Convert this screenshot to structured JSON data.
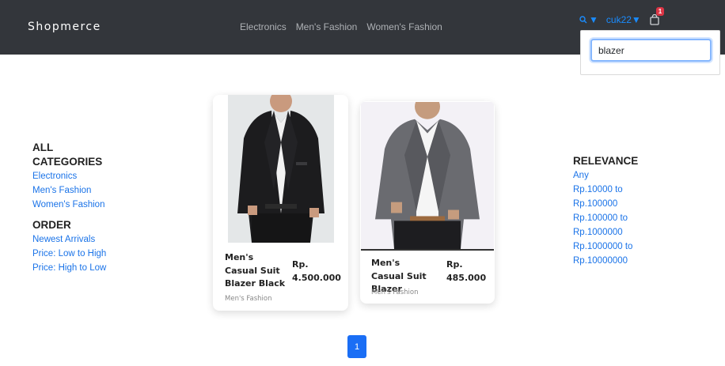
{
  "header": {
    "brand": "Shopmerce",
    "nav": [
      "Electronics",
      "Men's Fashion",
      "Women's Fashion"
    ],
    "search_toggle_icon": "search-icon",
    "search_caret": "▼",
    "user": "cuk22▼",
    "cart_count": "1"
  },
  "search": {
    "value": "blazer"
  },
  "filters": {
    "categories_title": "ALL CATEGORIES",
    "categories": [
      "Electronics",
      "Men's Fashion",
      "Women's Fashion"
    ],
    "order_title": "ORDER",
    "order": [
      "Newest Arrivals",
      "Price: Low to High",
      "Price: High to Low"
    ],
    "price_title": "RELEVANCE",
    "price": [
      "Any",
      "Rp.10000 to Rp.100000",
      "Rp.100000 to Rp.1000000",
      "Rp.1000000 to Rp.10000000"
    ]
  },
  "products": [
    {
      "name": "Men's Casual Suit Blazer Black",
      "price": "Rp. 4.500.000",
      "category": "Men's Fashion"
    },
    {
      "name": "Men's Casual Suit Blazer",
      "price": "Rp. 485.000",
      "category": "Men's Fashion"
    }
  ],
  "pagination": {
    "current": "1"
  }
}
